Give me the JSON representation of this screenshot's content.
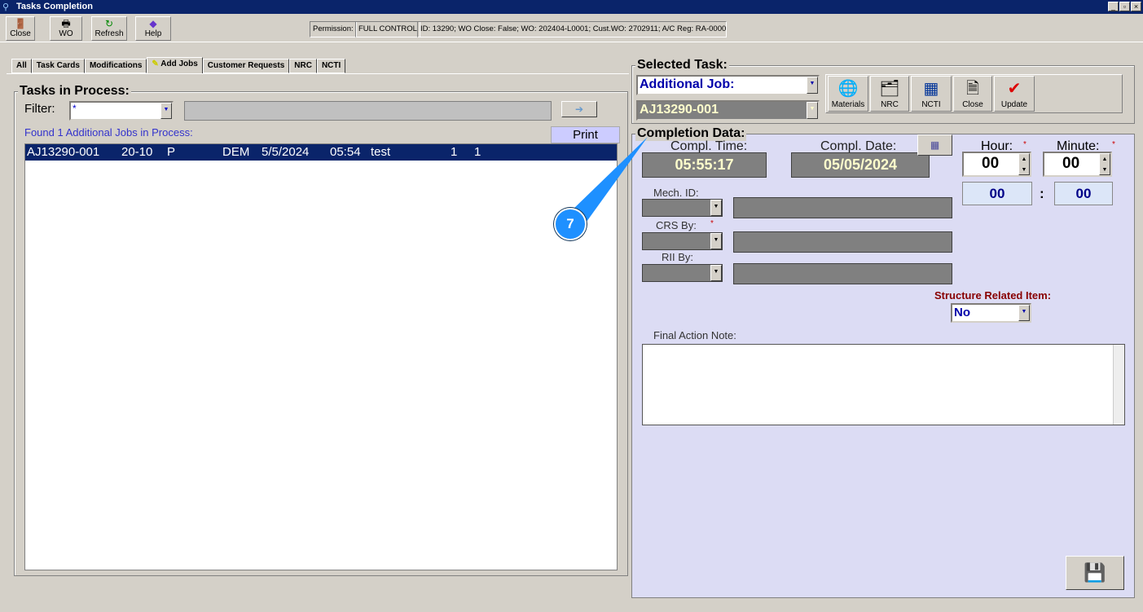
{
  "window": {
    "title": "Tasks Completion",
    "controls": [
      "_",
      "▫",
      "×"
    ]
  },
  "toolbar": {
    "buttons": [
      {
        "label": "Close",
        "icon": "door-exit-icon"
      },
      {
        "label": "WO",
        "icon": "printer-icon"
      },
      {
        "label": "Refresh",
        "icon": "refresh-arrow-icon"
      },
      {
        "label": "Help",
        "icon": "help-book-icon"
      }
    ],
    "permission_label": "Permission:",
    "permission_value": "FULL CONTROL",
    "status": "ID: 13290; WO Close: False; WO: 202404-L0001; Cust.WO: 2702911; A/C Reg: RA-0000"
  },
  "tabs": [
    "All",
    "Task Cards",
    "Modifications",
    "Add Jobs",
    "Customer Requests",
    "NRC",
    "NCTI"
  ],
  "tasks": {
    "title": "Tasks in Process:",
    "filter_label": "Filter:",
    "filter_value": "*",
    "found": "Found 1 Additional Jobs in Process:",
    "print": "Print",
    "rows": [
      {
        "id": "AJ13290-001",
        "code": "20-10",
        "status": "P",
        "by": "DEM",
        "date": "5/5/2024",
        "time": "05:54",
        "desc": "test",
        "a": "1",
        "b": "1"
      }
    ]
  },
  "selected": {
    "title": "Selected Task:",
    "type": "Additional Job:",
    "task": "AJ13290-001",
    "actions": [
      {
        "label": "Materials",
        "icon": "globe-hand-icon"
      },
      {
        "label": "NRC",
        "icon": "folder-docs-icon"
      },
      {
        "label": "NCTI",
        "icon": "import-sheet-icon"
      },
      {
        "label": "Close",
        "icon": "close-doc-icon"
      },
      {
        "label": "Update",
        "icon": "clipboard-check-icon"
      }
    ]
  },
  "completion": {
    "title": "Completion Data:",
    "time_label": "Compl. Time:",
    "time": "05:55:17",
    "date_label": "Compl. Date:",
    "date": "05/05/2024",
    "hour_label": "Hour:",
    "hour": "00",
    "minute_label": "Minute:",
    "minute": "00",
    "hour_display": "00",
    "minute_display": "00",
    "sep": ":",
    "req": "*",
    "mech_label": "Mech. ID:",
    "crs_label": "CRS By:",
    "rii_label": "RII By:",
    "sri_label": "Structure Related Item:",
    "sri_value": "No",
    "note_label": "Final Action Note:",
    "note": ""
  },
  "callout": {
    "number": "7",
    "color": "#1e90ff"
  }
}
